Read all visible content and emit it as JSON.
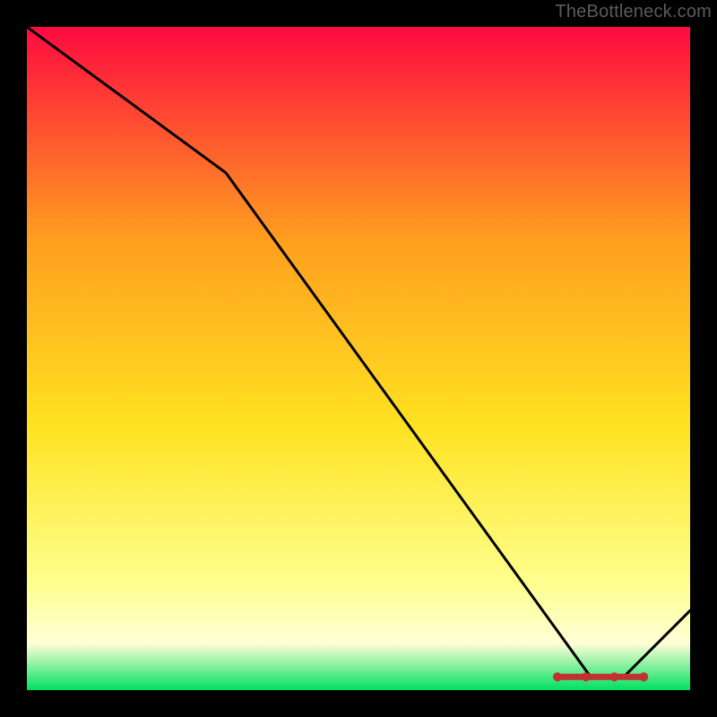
{
  "watermark": "TheBottleneck.com",
  "chart_data": {
    "type": "line",
    "title": "",
    "xlabel": "",
    "ylabel": "",
    "xlim": [
      0,
      100
    ],
    "ylim": [
      0,
      100
    ],
    "x": [
      0,
      30,
      85,
      90,
      100
    ],
    "values": [
      100,
      78,
      2,
      2,
      12
    ],
    "marker_band": {
      "x_start": 80,
      "x_end": 93,
      "y": 2
    },
    "background_gradient": {
      "top": "#ff0a40",
      "mid_upper": "#ff9e1f",
      "mid": "#ffe220",
      "mid_lower": "#feff8f",
      "low": "#ffffd7",
      "bottom": "#00e060"
    }
  }
}
